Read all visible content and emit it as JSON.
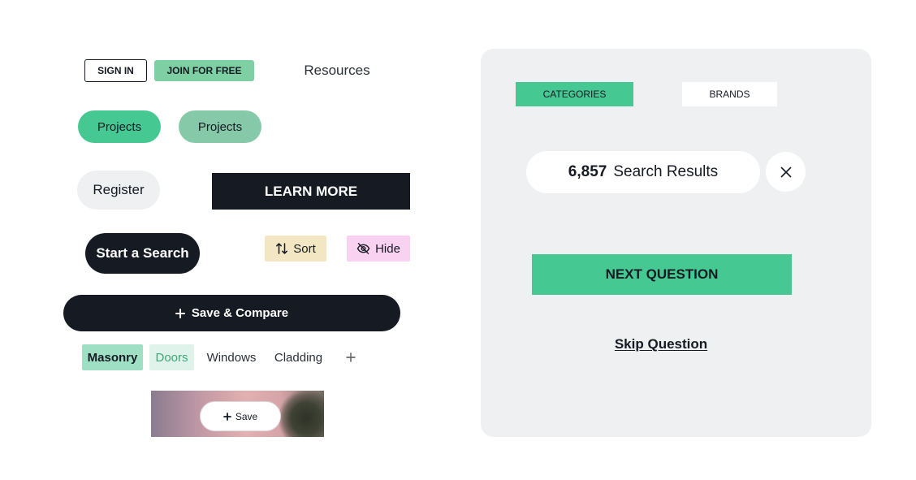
{
  "header": {
    "sign_in": "SIGN IN",
    "join_free": "JOIN FOR FREE",
    "resources": "Resources"
  },
  "buttons": {
    "projects_primary": "Projects",
    "projects_secondary": "Projects",
    "register": "Register",
    "learn_more": "LEARN MORE",
    "start_search": "Start a Search",
    "sort": "Sort",
    "hide": "Hide",
    "save_compare": "Save & Compare"
  },
  "tags": {
    "items": [
      "Masonry",
      "Doors",
      "Windows",
      "Cladding"
    ]
  },
  "image_card": {
    "save_label": "Save"
  },
  "panel": {
    "tabs": [
      "CATEGORIES",
      "BRANDS"
    ],
    "results_count": "6,857",
    "results_label": "Search Results",
    "next_question": "NEXT QUESTION",
    "skip_question": "Skip Question"
  },
  "colors": {
    "brand_green": "#46c892",
    "dark": "#151a23",
    "panel_bg": "#eff0f2",
    "sort_bg": "#f3e7c3",
    "hide_bg": "#f9d2f1"
  },
  "icons": {
    "sort": "sort-arrows-icon",
    "hide": "eye-off-icon",
    "plus": "plus-icon",
    "close": "close-icon"
  }
}
